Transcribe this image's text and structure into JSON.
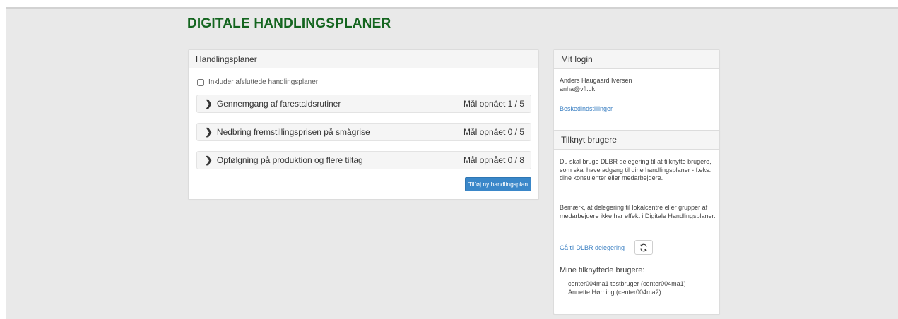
{
  "header": {
    "title": "DIGITALE HANDLINGSPLANER"
  },
  "plans_panel": {
    "title": "Handlingsplaner",
    "include_completed_label": "Inkluder afsluttede handlingsplaner",
    "plans": [
      {
        "name": "Gennemgang af farestaldsrutiner",
        "status": "Mål opnået 1 / 5"
      },
      {
        "name": "Nedbring fremstillingsprisen på smågrise",
        "status": "Mål opnået 0 / 5"
      },
      {
        "name": "Opfølgning på produktion og flere tiltag",
        "status": "Mål opnået 0 / 8"
      }
    ],
    "add_button": "Tilføj ny handlingsplan"
  },
  "login_panel": {
    "title": "Mit login",
    "user_name": "Anders Haugaard Iversen",
    "user_email": "anha@vfl.dk",
    "settings_link": "Beskedindstillinger"
  },
  "link_panel": {
    "title": "Tilknyt brugere",
    "paragraph1": "Du skal bruge DLBR delegering til at tilknytte brugere, som skal have adgang til dine handlingsplaner - f.eks. dine konsulenter eller medarbejdere.",
    "paragraph2": "Bemærk, at delegering til lokalcentre eller grupper af medarbejdere ikke har effekt i Digitale Handlingsplaner.",
    "delegation_link": "Gå til DLBR delegering",
    "refresh_icon": "refresh-icon",
    "linked_users_title": "Mine tilknyttede brugere:",
    "linked_users": [
      "center004ma1 testbruger (center004ma1)",
      "Annette Hørning (center004ma2)"
    ]
  },
  "colors": {
    "title_green": "#14651f",
    "primary_blue": "#3a87c9",
    "link_blue": "#3a7fc2"
  }
}
